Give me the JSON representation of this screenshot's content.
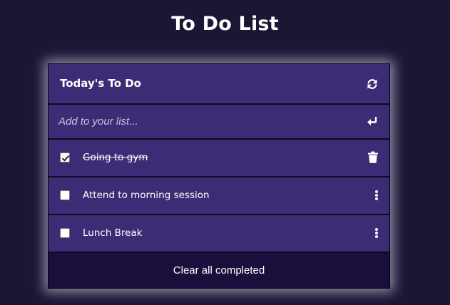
{
  "page": {
    "title": "To Do List"
  },
  "card": {
    "header_title": "Today's To Do",
    "header_icon": "refresh-icon",
    "input_placeholder": "Add to your list...",
    "input_icon": "enter-icon",
    "items": [
      {
        "label": "Going to gym",
        "completed": true,
        "action_icon": "trash-icon"
      },
      {
        "label": "Attend to morning session",
        "completed": false,
        "action_icon": "kebab-menu-icon"
      },
      {
        "label": "Lunch Break",
        "completed": false,
        "action_icon": "kebab-menu-icon"
      }
    ],
    "footer_label": "Clear all completed"
  },
  "colors": {
    "page_background": "#1b1633",
    "row_background": "#3d2b76",
    "footer_background": "#1a0f3c"
  }
}
